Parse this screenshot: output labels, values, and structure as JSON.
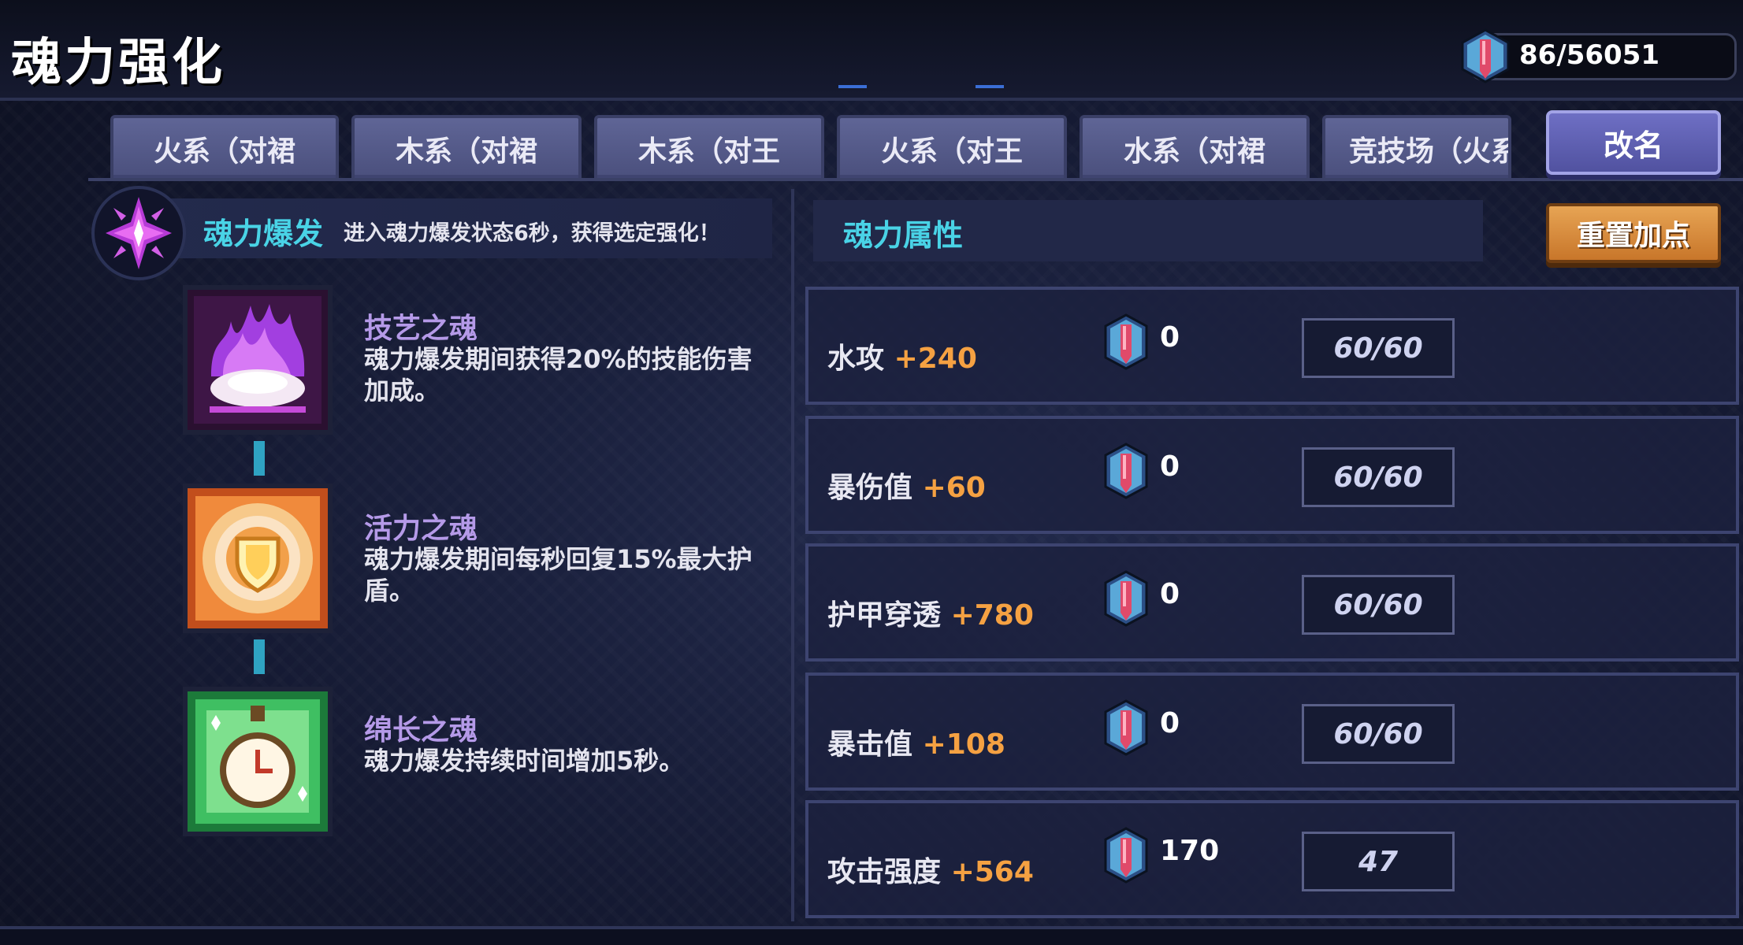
{
  "header": {
    "title": "魂力强化",
    "currency_value": "86/56051"
  },
  "tabs": [
    {
      "label": "火系（对裙"
    },
    {
      "label": "木系（对裙"
    },
    {
      "label": "木系（对王"
    },
    {
      "label": "火系（对王"
    },
    {
      "label": "水系（对裙"
    },
    {
      "label": "竞技场（火系"
    }
  ],
  "buttons": {
    "rename": "改名",
    "reset": "重置加点"
  },
  "burst": {
    "name": "魂力爆发",
    "description": "进入魂力爆发状态6秒，获得选定强化！"
  },
  "skills": [
    {
      "name": "技艺之魂",
      "desc": "魂力爆发期间获得20%的技能伤害加成。",
      "icon": "purple-flame-icon"
    },
    {
      "name": "活力之魂",
      "desc": "魂力爆发期间每秒回复15%最大护盾。",
      "icon": "shield-icon"
    },
    {
      "name": "绵长之魂",
      "desc": "魂力爆发持续时间增加5秒。",
      "icon": "stopwatch-icon"
    }
  ],
  "attributes": {
    "title": "魂力属性",
    "rows": [
      {
        "name": "水攻",
        "bonus": "+240",
        "cost": "0",
        "level": "60/60"
      },
      {
        "name": "暴伤值",
        "bonus": "+60",
        "cost": "0",
        "level": "60/60"
      },
      {
        "name": "护甲穿透",
        "bonus": "+780",
        "cost": "0",
        "level": "60/60"
      },
      {
        "name": "暴击值",
        "bonus": "+108",
        "cost": "0",
        "level": "60/60"
      },
      {
        "name": "攻击强度",
        "bonus": "+564",
        "cost": "170",
        "level": "47"
      }
    ]
  },
  "colors": {
    "accent_cyan": "#49d3e6",
    "bonus_orange": "#f5a142",
    "skill_name_purple": "#b59ae8",
    "rename_button": "#5f60b2",
    "reset_button": "#d88a3c"
  }
}
